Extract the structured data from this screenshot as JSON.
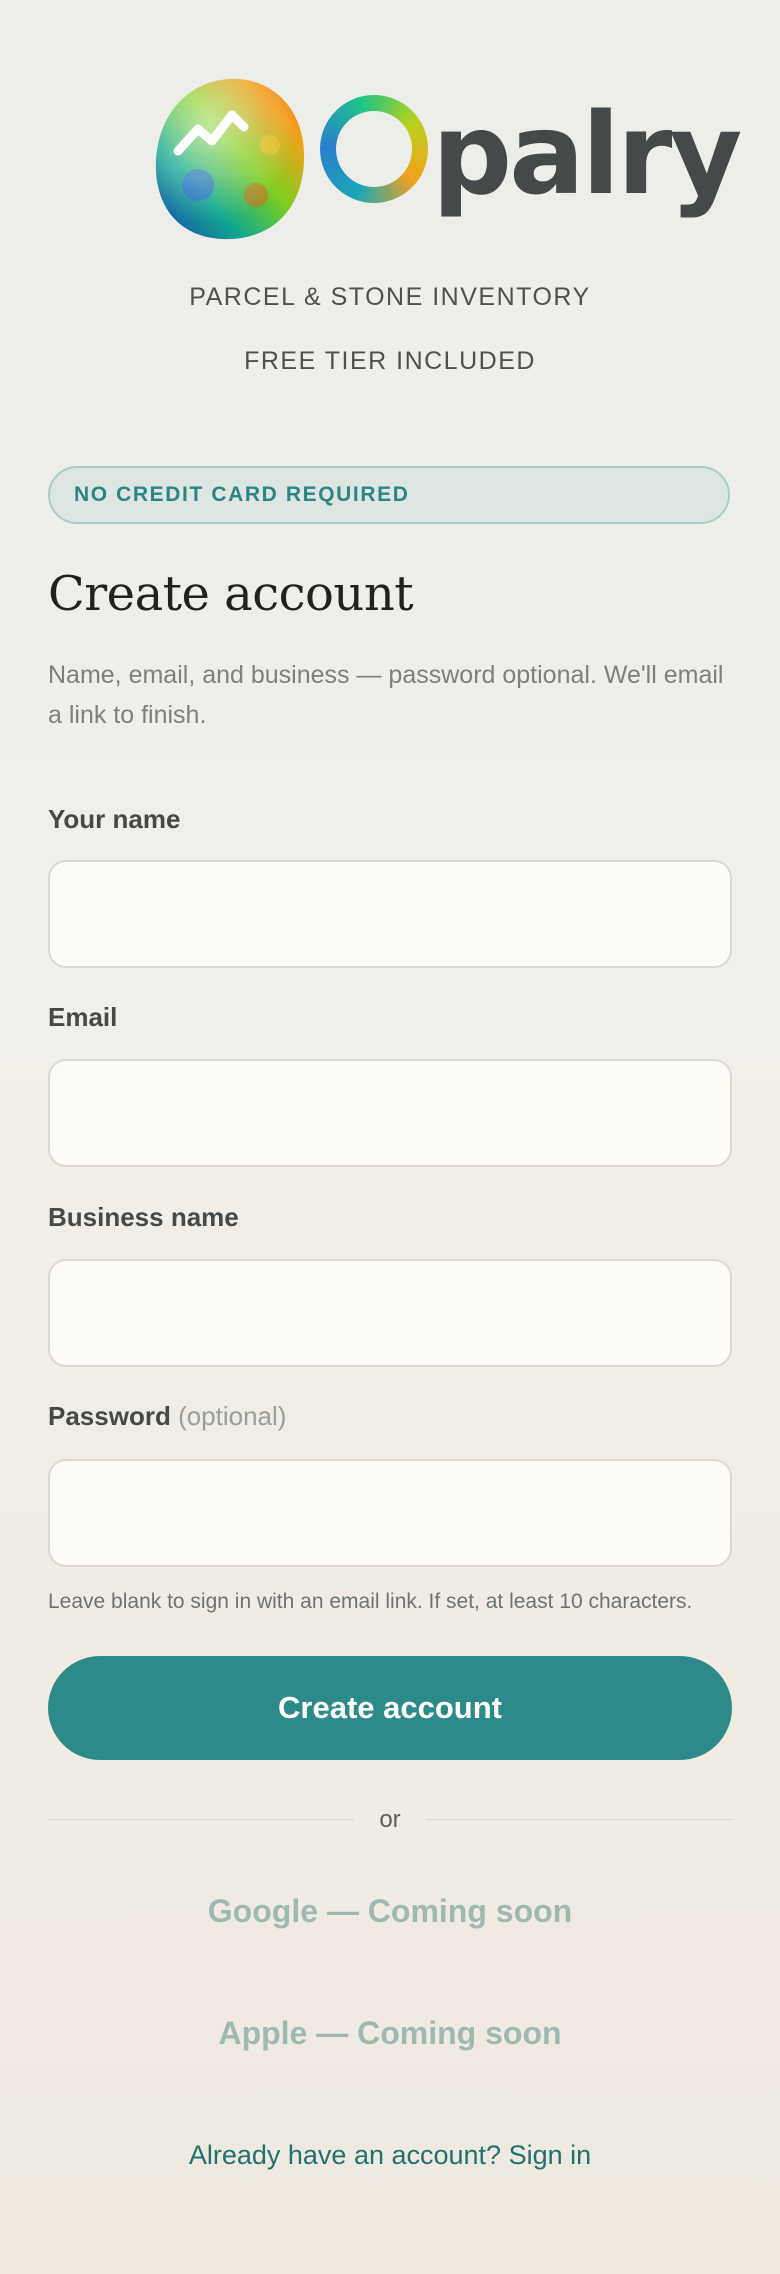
{
  "brand": {
    "name_rest": "palry",
    "tagline": "PARCEL & STONE INVENTORY",
    "tier_note": "FREE TIER INCLUDED"
  },
  "badge": "NO CREDIT CARD REQUIRED",
  "heading": {
    "title": "Create account",
    "subtitle": "Name, email, and business — password optional. We'll email a link to finish."
  },
  "form": {
    "name_label": "Your name",
    "name_value": "",
    "email_label": "Email",
    "email_value": "",
    "business_label": "Business name",
    "business_value": "",
    "password_label": "Password",
    "password_optional": "(optional)",
    "password_value": "",
    "password_hint": "Leave blank to sign in with an email link. If set, at least 10 characters.",
    "submit_label": "Create account"
  },
  "divider_text": "or",
  "social": {
    "google": "Google — Coming soon",
    "apple": "Apple — Coming soon"
  },
  "signin": {
    "prompt": "Already have an account?",
    "link": "Sign in"
  },
  "colors": {
    "accent": "#2e8a88",
    "accent_text": "#22716e",
    "badge_bg": "#dde6e2",
    "disabled_text": "#9fb9b2",
    "field_bg": "#fdfbf5"
  },
  "icons": {
    "logo": "opal-stone-logo"
  }
}
